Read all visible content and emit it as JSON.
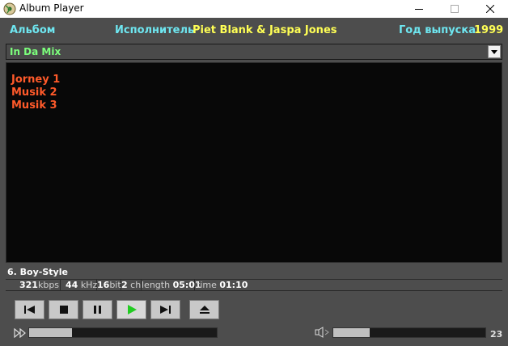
{
  "window": {
    "title": "Album Player"
  },
  "header": {
    "album_label": "Альбом",
    "artist_label": "Исполнитель",
    "artist_value": "Piet Blank & Jaspa Jones",
    "year_label": "Год выпуска",
    "year_value": "1999"
  },
  "album_select": {
    "selected": "In Da Mix"
  },
  "playlist": {
    "tracks": [
      "Jorney 1",
      "Musik 2",
      "Musik 3"
    ]
  },
  "now_playing": {
    "text": "6.  Boy-Style"
  },
  "info": {
    "bitrate": "321",
    "bitrate_unit": "kbps",
    "samplerate": "44",
    "samplerate_unit": "kHz",
    "bits": "16",
    "bits_unit": "bit",
    "channels": "2",
    "channels_unit": "ch",
    "length_label": "length",
    "length_value": "05:01",
    "time_label": "time",
    "time_value": "01:10"
  },
  "controls": [
    "previous",
    "stop",
    "pause",
    "play",
    "next",
    "eject"
  ],
  "seek": {
    "progress_fraction": 0.23
  },
  "volume": {
    "value": "23",
    "fraction": 0.24
  },
  "colors": {
    "label_cyan": "#6ee6f0",
    "value_yellow": "#ffff55",
    "album_green": "#7cff7c",
    "track_orange": "#ff5a2a",
    "play_green": "#22cc22"
  }
}
